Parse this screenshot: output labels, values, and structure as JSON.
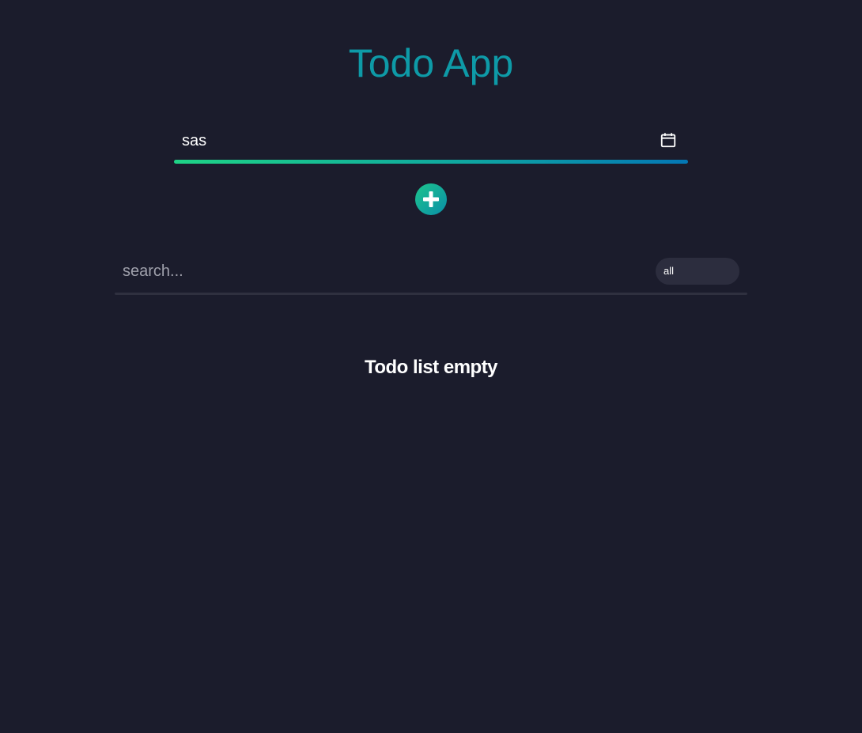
{
  "app": {
    "title": "Todo App",
    "accent_color": "#0e9aa7",
    "background_color": "#1b1c2c"
  },
  "new_todo": {
    "value": "sas",
    "icon": "calendar-icon",
    "underline_gradient": [
      "#1fd386",
      "#10a8a0",
      "#0477b5"
    ]
  },
  "add_button": {
    "icon": "plus-icon"
  },
  "filter_bar": {
    "search_placeholder": "search...",
    "search_value": "",
    "filter_selected": "all"
  },
  "todo_list": {
    "empty_message": "Todo list empty",
    "items": []
  }
}
